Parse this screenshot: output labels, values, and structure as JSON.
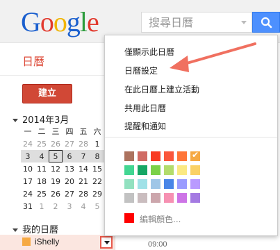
{
  "header": {
    "logo_letters": [
      "G",
      "o",
      "o",
      "g",
      "l",
      "e"
    ],
    "logo_colors": [
      "#1a5fce",
      "#e23a2e",
      "#f0b400",
      "#1a5fce",
      "#2c9c3c",
      "#e23a2e"
    ],
    "search_placeholder": "搜尋日曆"
  },
  "sidebar": {
    "app_title": "日曆",
    "create_label": "建立",
    "mini_title": "2014年3月",
    "weekday_headers": [
      "一",
      "二",
      "三",
      "四",
      "五",
      "六",
      "日"
    ],
    "weeks": [
      [
        "24",
        "25",
        "26",
        "27",
        "28",
        "1",
        "2"
      ],
      [
        "3",
        "4",
        "5",
        "6",
        "7",
        "8",
        "9"
      ],
      [
        "10",
        "11",
        "12",
        "13",
        "14",
        "15",
        "16"
      ],
      [
        "17",
        "18",
        "19",
        "20",
        "21",
        "22",
        "23"
      ],
      [
        "24",
        "25",
        "26",
        "27",
        "28",
        "29",
        "30"
      ],
      [
        "31",
        "1",
        "2",
        "3",
        "4",
        "5",
        "6"
      ]
    ],
    "my_calendars_label": "我的日曆",
    "calendar_name": "iShelly"
  },
  "main": {
    "time_label": "09:00"
  },
  "menu": {
    "items": [
      "僅顯示此日曆",
      "日曆設定",
      "在此日曆上建立活動",
      "共用此日曆",
      "提醒和通知"
    ],
    "colors": [
      [
        "#ac725e",
        "#d06b64",
        "#f83a22",
        "#fa573c",
        "#ff7537",
        "#f6a943"
      ],
      [
        "#42d692",
        "#16a765",
        "#7bd148",
        "#b3dc6c",
        "#fbe983",
        "#fad165"
      ],
      [
        "#92e1c0",
        "#9fe1e7",
        "#9fc6e7",
        "#4986e7",
        "#9a9cff",
        "#b99aff"
      ],
      [
        "#c2c2c2",
        "#cabdbf",
        "#cca6ac",
        "#f691b2",
        "#cd74e6",
        "#a47ae2"
      ]
    ],
    "selected_color": "#f6a943",
    "edit_color_label": "編輯顏色...",
    "edit_color_swatch": "#ff0000",
    "check_glyph": "✔"
  },
  "annotation_color": "#f07060"
}
